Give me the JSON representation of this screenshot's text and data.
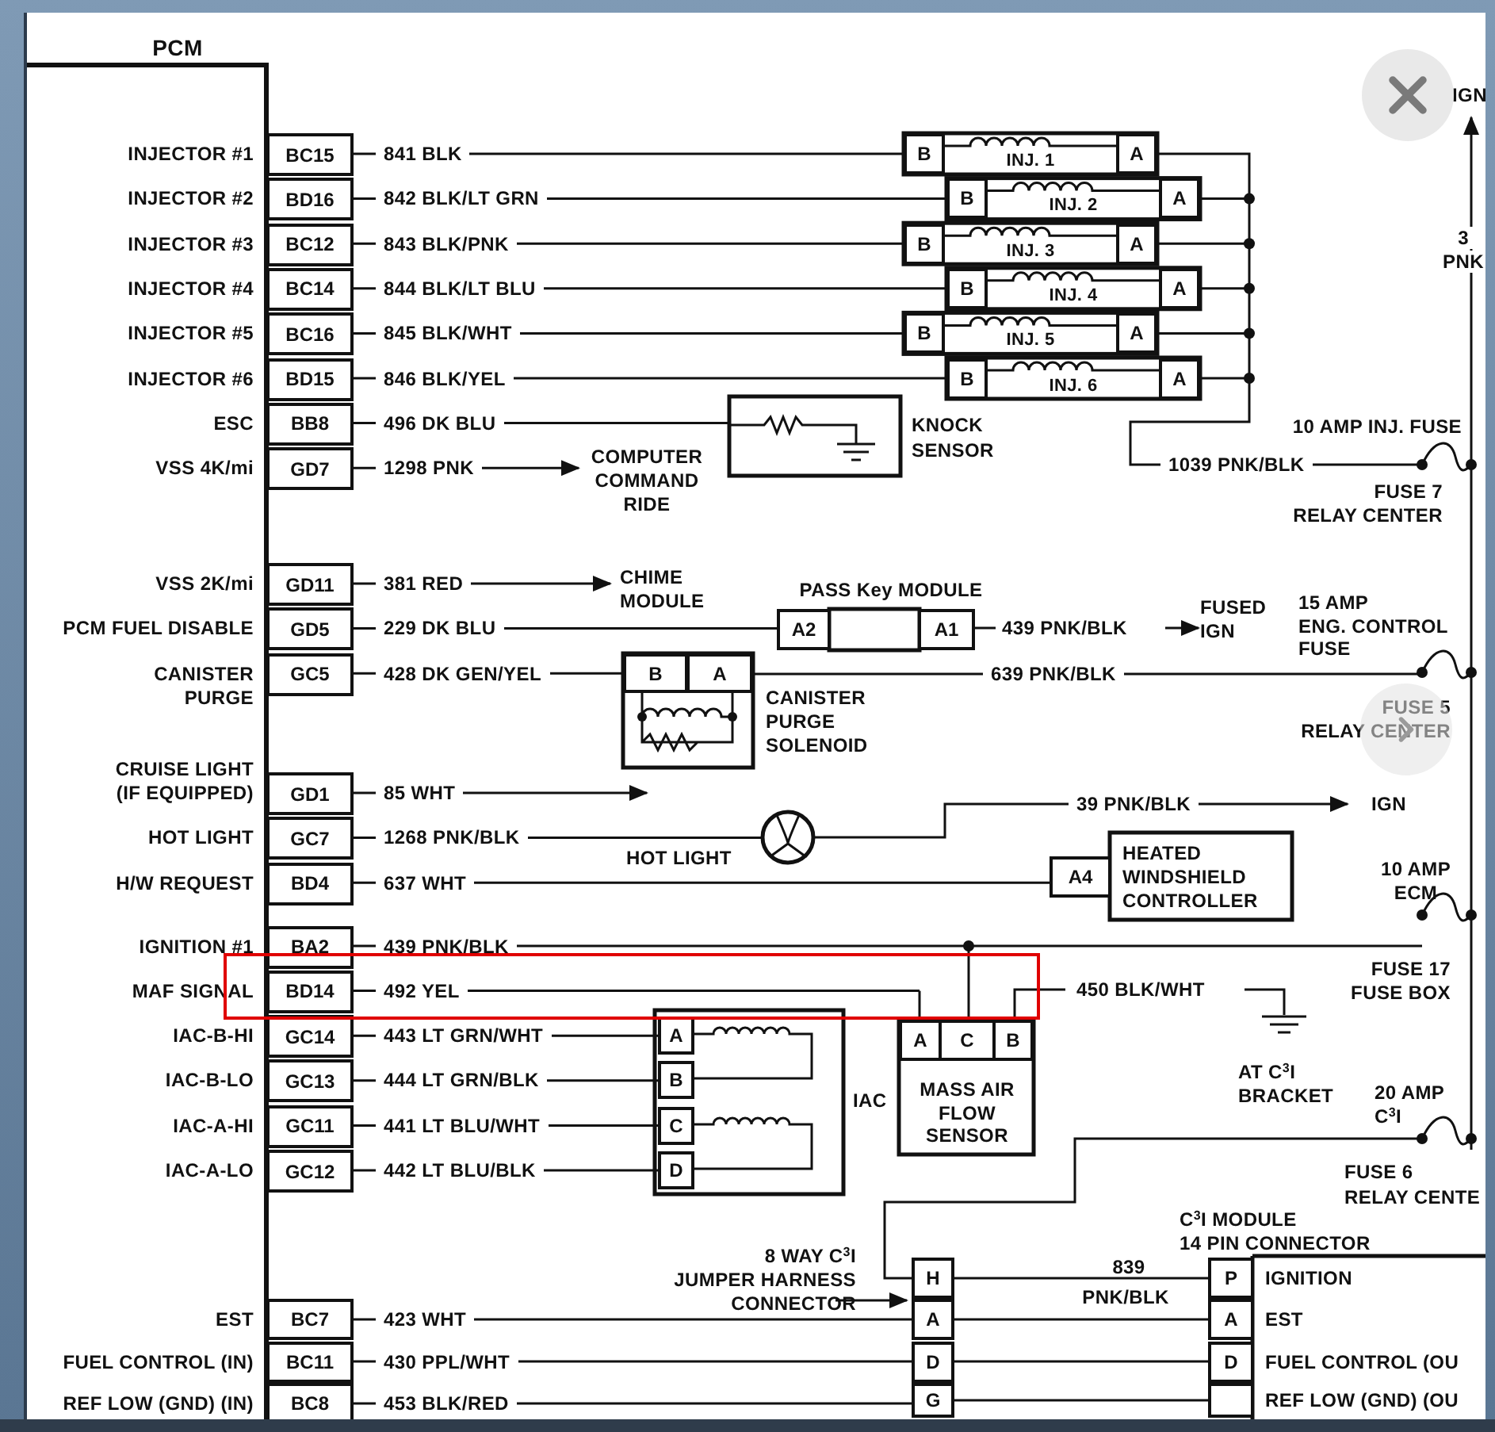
{
  "pcm": {
    "title": "PCM",
    "groups": [
      [
        {
          "label": [
            "INJECTOR #1"
          ],
          "pin": "BC15",
          "wire": "841 BLK"
        },
        {
          "label": [
            "INJECTOR #2"
          ],
          "pin": "BD16",
          "wire": "842 BLK/LT GRN"
        },
        {
          "label": [
            "INJECTOR #3"
          ],
          "pin": "BC12",
          "wire": "843 BLK/PNK"
        },
        {
          "label": [
            "INJECTOR #4"
          ],
          "pin": "BC14",
          "wire": "844 BLK/LT BLU"
        },
        {
          "label": [
            "INJECTOR #5"
          ],
          "pin": "BC16",
          "wire": "845 BLK/WHT"
        },
        {
          "label": [
            "INJECTOR #6"
          ],
          "pin": "BD15",
          "wire": "846 BLK/YEL"
        },
        {
          "label": [
            "ESC"
          ],
          "pin": "BB8",
          "wire": "496 DK BLU"
        },
        {
          "label": [
            "VSS 4K/mi"
          ],
          "pin": "GD7",
          "wire": "1298 PNK"
        }
      ],
      [
        {
          "label": [
            "VSS 2K/mi"
          ],
          "pin": "GD11",
          "wire": "381 RED"
        },
        {
          "label": [
            "PCM FUEL DISABLE"
          ],
          "pin": "GD5",
          "wire": "229 DK BLU"
        },
        {
          "label": [
            "CANISTER",
            "PURGE"
          ],
          "pin": "GC5",
          "wire": "428 DK GEN/YEL"
        }
      ],
      [
        {
          "label": [
            "CRUISE LIGHT",
            "(IF EQUIPPED)"
          ],
          "pin": "GD1",
          "wire": "85 WHT"
        },
        {
          "label": [
            "HOT LIGHT"
          ],
          "pin": "GC7",
          "wire": "1268 PNK/BLK"
        },
        {
          "label": [
            "H/W REQUEST"
          ],
          "pin": "BD4",
          "wire": "637 WHT"
        }
      ],
      [
        {
          "label": [
            "IGNITION #1"
          ],
          "pin": "BA2",
          "wire": "439 PNK/BLK"
        },
        {
          "label": [
            "MAF SIGNAL"
          ],
          "pin": "BD14",
          "wire": "492 YEL"
        },
        {
          "label": [
            "IAC-B-HI"
          ],
          "pin": "GC14",
          "wire": "443 LT GRN/WHT"
        },
        {
          "label": [
            "IAC-B-LO"
          ],
          "pin": "GC13",
          "wire": "444 LT GRN/BLK"
        },
        {
          "label": [
            "IAC-A-HI"
          ],
          "pin": "GC11",
          "wire": "441 LT BLU/WHT"
        },
        {
          "label": [
            "IAC-A-LO"
          ],
          "pin": "GC12",
          "wire": "442 LT BLU/BLK"
        }
      ],
      [
        {
          "label": [
            "EST"
          ],
          "pin": "BC7",
          "wire": "423 WHT"
        },
        {
          "label": [
            "FUEL CONTROL (IN)"
          ],
          "pin": "BC11",
          "wire": "430 PPL/WHT"
        },
        {
          "label": [
            "REF LOW (GND) (IN)"
          ],
          "pin": "BC8",
          "wire": "453 BLK/RED"
        }
      ]
    ]
  },
  "injectors": [
    {
      "label": "INJ. 1",
      "terminals": [
        "B",
        "A"
      ]
    },
    {
      "label": "INJ. 2",
      "terminals": [
        "B",
        "A"
      ]
    },
    {
      "label": "INJ. 3",
      "terminals": [
        "B",
        "A"
      ]
    },
    {
      "label": "INJ. 4",
      "terminals": [
        "B",
        "A"
      ]
    },
    {
      "label": "INJ. 5",
      "terminals": [
        "B",
        "A"
      ]
    },
    {
      "label": "INJ. 6",
      "terminals": [
        "B",
        "A"
      ]
    }
  ],
  "injector_feed": "1039 PNK/BLK",
  "supply": {
    "label": "IGN",
    "wire": [
      "3",
      "PNK"
    ]
  },
  "knock_sensor": {
    "label": [
      "KNOCK",
      "SENSOR"
    ]
  },
  "ride_control": {
    "label": [
      "COMPUTER",
      "COMMAND",
      "RIDE"
    ]
  },
  "chime": {
    "label": [
      "CHIME",
      "MODULE"
    ]
  },
  "pass_key": {
    "title": "PASS Key MODULE",
    "terminals": [
      "A2",
      "A1"
    ],
    "wire": "439 PNK/BLK",
    "destination": [
      "FUSED",
      "IGN"
    ]
  },
  "purge_solenoid": {
    "terminals": [
      "B",
      "A"
    ],
    "label": [
      "CANISTER",
      "PURGE",
      "SOLENOID"
    ],
    "wire": "639 PNK/BLK"
  },
  "hot_light": {
    "label": "HOT LIGHT",
    "wire": "39 PNK/BLK",
    "destination": "IGN"
  },
  "windshield": {
    "terminal": "A4",
    "label": [
      "HEATED",
      "WINDSHIELD",
      "CONTROLLER"
    ]
  },
  "fuses": [
    {
      "rating": [
        "10 AMP INJ. FUSE"
      ],
      "location": [
        "FUSE 7",
        "RELAY CENTER"
      ]
    },
    {
      "rating": [
        "15  AMP",
        "ENG. CONTROL",
        "FUSE"
      ],
      "location": [
        "FUSE 5",
        "RELAY CENTER"
      ]
    },
    {
      "rating": [
        "10 AMP",
        "ECM"
      ],
      "location": [
        "FUSE 17",
        "FUSE BOX"
      ]
    },
    {
      "rating": [
        "20 AMP",
        "C$^{3}$I"
      ],
      "location": [
        "FUSE 6",
        "RELAY CENTE"
      ]
    }
  ],
  "maf": {
    "terminals": [
      "A",
      "C",
      "B"
    ],
    "label": [
      "MASS AIR",
      "FLOW",
      "SENSOR"
    ],
    "ground_wire": "450 BLK/WHT",
    "ground_label": [
      "AT C$^{3}$I",
      "BRACKET"
    ]
  },
  "iac": {
    "terminals": [
      "A",
      "B",
      "C",
      "D"
    ],
    "label": "IAC"
  },
  "jumper": {
    "label": [
      "8 WAY C$^{3}$I",
      "JUMPER HARNESS",
      "CONNECTOR"
    ],
    "terminals": [
      "H",
      "A",
      "D",
      "G"
    ],
    "wire": [
      "839",
      "PNK/BLK"
    ]
  },
  "c3i_module": {
    "title": [
      "C$^{3}$I MODULE",
      "14 PIN CONNECTOR"
    ],
    "pins": [
      {
        "terminal": "P",
        "function": "IGNITION"
      },
      {
        "terminal": "A",
        "function": "EST"
      },
      {
        "terminal": "D",
        "function": "FUEL CONTROL (OU"
      },
      {
        "function": "REF LOW (GND) (OU"
      }
    ]
  }
}
